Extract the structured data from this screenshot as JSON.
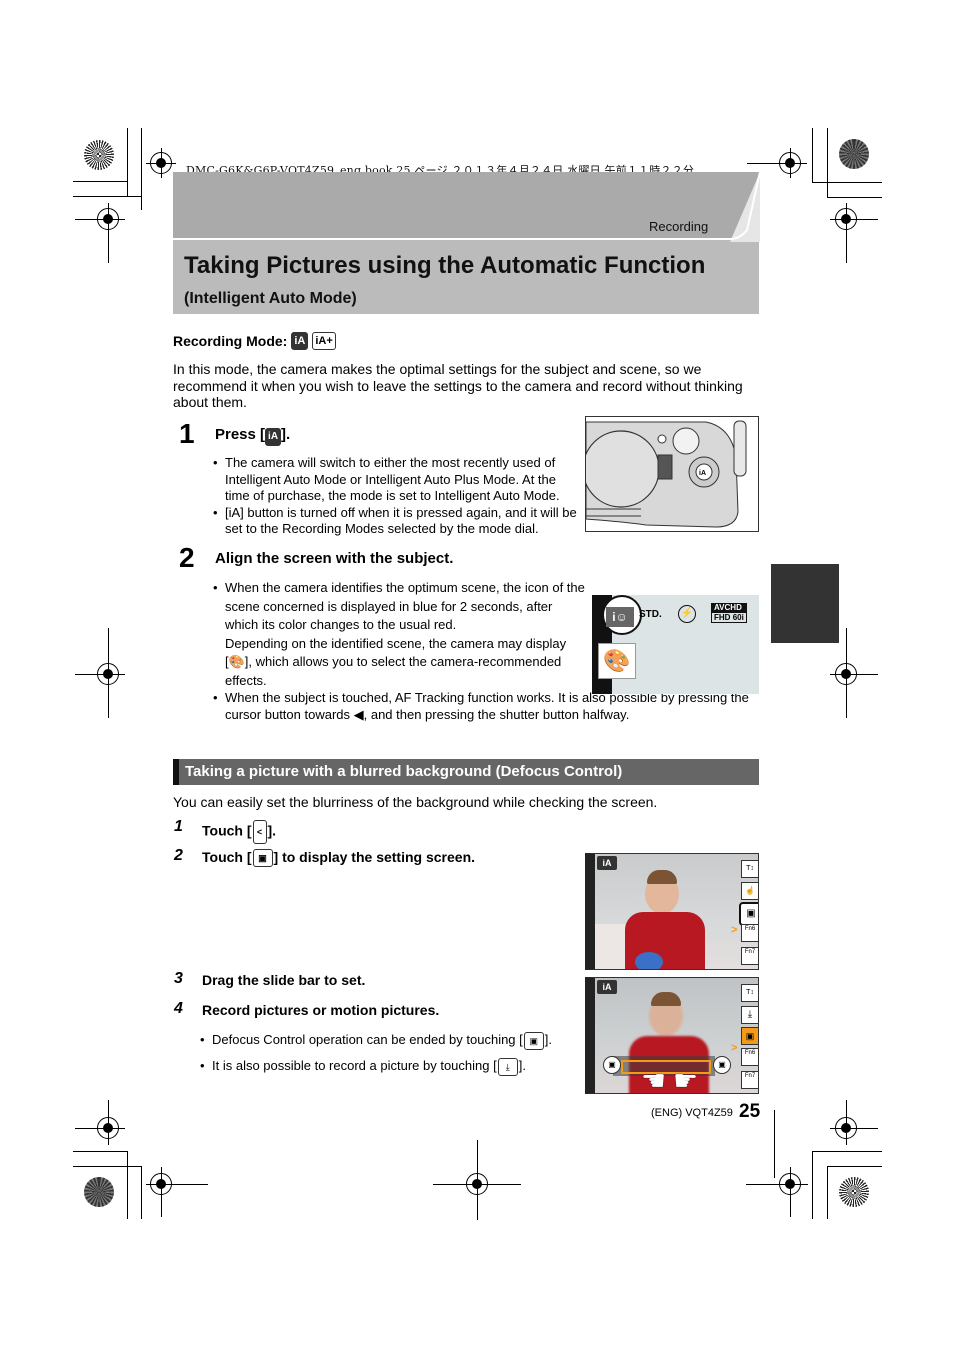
{
  "print_info": "DMC-G6K&G6P-VQT4Z59_eng.book  25 ページ  ２０１３年４月２４日  水曜日  午前１１時２２分",
  "header": {
    "section": "Recording",
    "title": "Taking Pictures using the Automatic Function",
    "subtitle": "(Intelligent Auto Mode)"
  },
  "recording_mode": {
    "label": "Recording Mode:",
    "icons": [
      {
        "name": "intelligent-auto-icon",
        "text": "iA"
      },
      {
        "name": "intelligent-auto-plus-icon",
        "text": "iA+"
      }
    ]
  },
  "intro": "In this mode, the camera makes the optimal settings for the subject and scene, so we recommend it when you wish to leave the settings to the camera and record without thinking about them.",
  "steps": [
    {
      "number": "1",
      "title_pre": "Press [",
      "title_icon": "iA",
      "title_post": "].",
      "bullets": [
        "The camera will switch to either the most recently used of Intelligent Auto Mode or Intelligent Auto Plus Mode. At the time of purchase, the mode is set to Intelligent Auto Mode.",
        "[iA] button is turned off when it is pressed again, and it will be set to the Recording Modes selected by the mode dial."
      ]
    },
    {
      "number": "2",
      "title": "Align the screen with the subject.",
      "bullets": [
        "When the camera identifies the optimum scene, the icon of the scene concerned is displayed in blue for 2 seconds, after which its color changes to the usual red.",
        "Depending on the identified scene, the camera may display [🎨], which allows you to select the camera-recommended effects.",
        "When the subject is touched, AF Tracking function works. It is also possible by pressing the cursor button towards ◀, and then pressing the shutter button halfway."
      ]
    }
  ],
  "camera_screen": {
    "scene_icon": "i☺",
    "std": "STD.",
    "avchd": "AVCHD",
    "fhd": "FHD",
    "rate": "60i"
  },
  "camera_button_label": "iA",
  "defocus": {
    "heading": "Taking a picture with a blurred background (Defocus Control)",
    "intro": "You can easily set the blurriness of the background while checking the screen.",
    "steps": [
      {
        "number": "1",
        "pre": "Touch [",
        "icon": "<",
        "post": "]."
      },
      {
        "number": "2",
        "pre": "Touch [",
        "icon": "▣",
        "post": "] to display the setting screen."
      },
      {
        "number": "3",
        "text": "Drag the slide bar to set."
      },
      {
        "number": "4",
        "text": "Record pictures or motion pictures."
      }
    ],
    "bullets": [
      {
        "pre": "Defocus Control operation can be ended by touching [",
        "icon": "▣",
        "post": "]."
      },
      {
        "pre": "It is also possible to record a picture by touching [",
        "icon": "⤓",
        "post": "]."
      }
    ],
    "screen_labels": {
      "ia": "iA",
      "zoom": "T W ↕",
      "fn6": "Fn6",
      "fn7": "Fn7",
      "arrow": ">"
    }
  },
  "footer": {
    "code": "(ENG) VQT4Z59",
    "page": "25"
  }
}
